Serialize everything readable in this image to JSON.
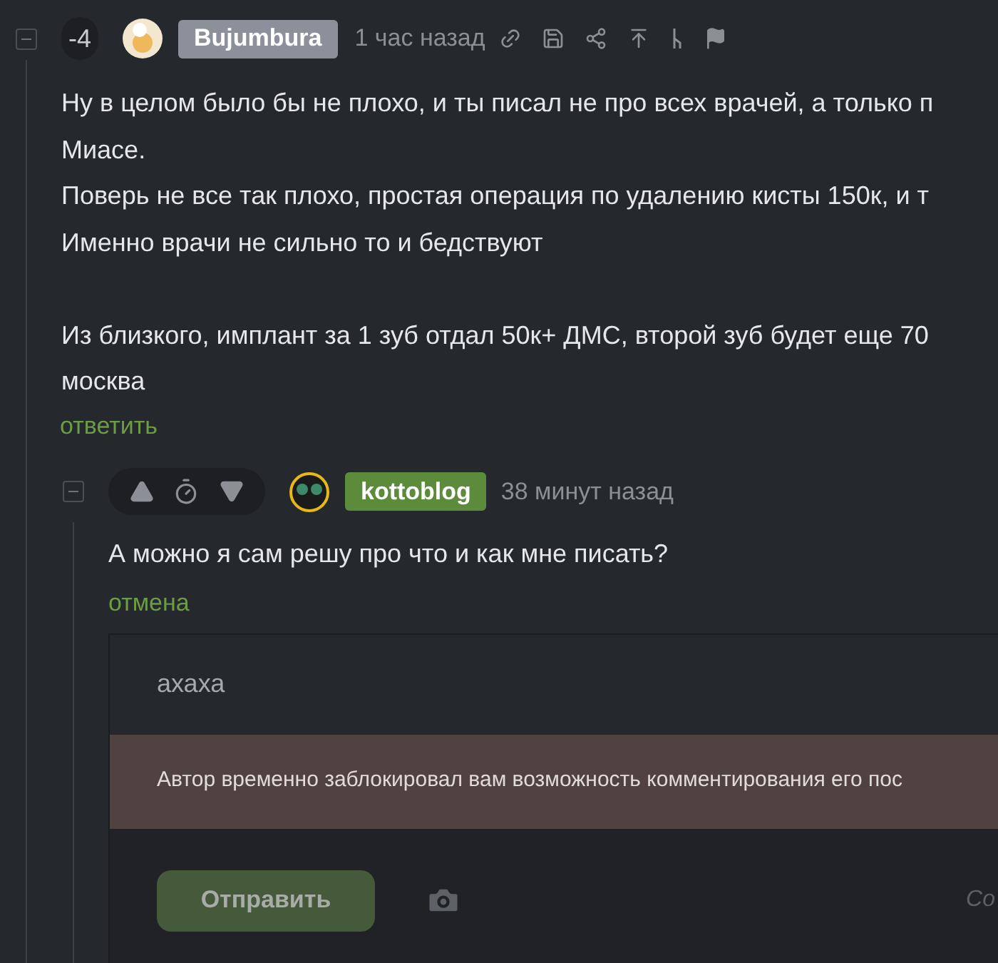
{
  "comment": {
    "collapsed": false,
    "score": "-4",
    "username": "Bujumbura",
    "time": "1 час назад",
    "paragraphs": [
      [
        "Ну в целом было бы не плохо, и ты писал не про всех врачей, а только п",
        "Миасе.",
        "Поверь не все так плохо, простая операция по удалению кисты 150к, и т",
        "Именно врачи не сильно то и бедствуют"
      ],
      [
        "Из близкого, имплант за 1 зуб отдал 50к+ ДМС, второй зуб будет еще 70",
        "москва"
      ]
    ],
    "reply_link": "ответить"
  },
  "reply": {
    "collapsed": false,
    "username": "kottoblog",
    "time": "38 минут назад",
    "text": "А можно я сам решу про что и как мне писать?",
    "cancel_link": "отмена"
  },
  "form": {
    "value": "ахаха",
    "notice": "Автор временно заблокировал вам возможность комментирования его пос",
    "submit": "Отправить",
    "disabled": true,
    "side_text": "Со"
  }
}
